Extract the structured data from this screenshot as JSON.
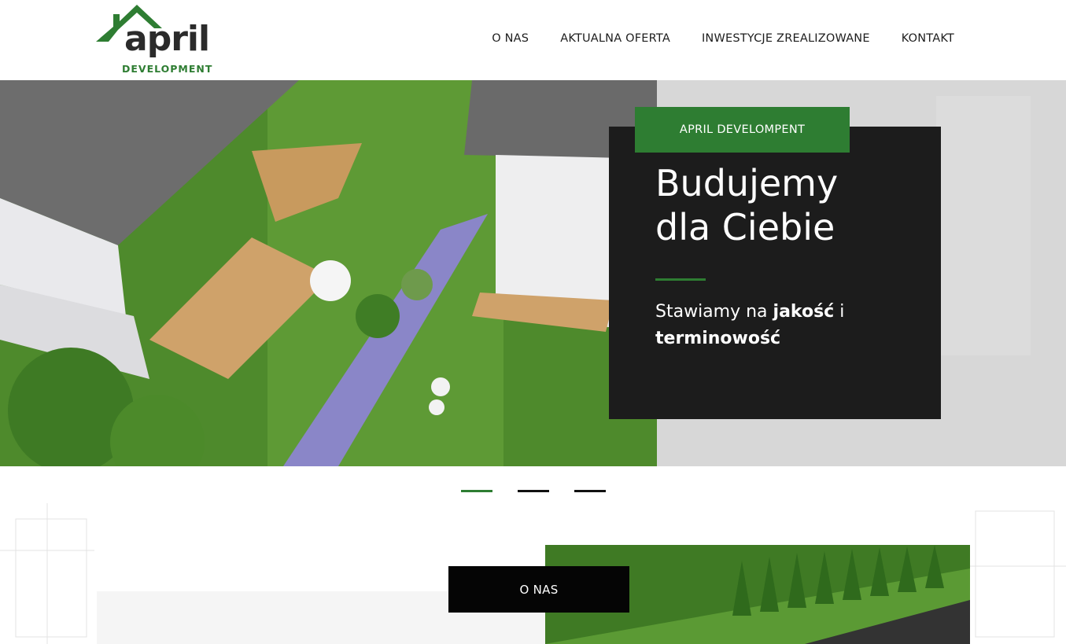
{
  "brand": {
    "name": "april",
    "sub": "DEVELOPMENT",
    "green": "#2e7d32",
    "dark": "#1c1c1c"
  },
  "nav": [
    {
      "label": "O NAS"
    },
    {
      "label": "AKTUALNA OFERTA"
    },
    {
      "label": "INWESTYCJE ZREALIZOWANE"
    },
    {
      "label": "KONTAKT"
    }
  ],
  "hero": {
    "tag": "APRIL DEVELOMPENT",
    "title_line1": "Budujemy",
    "title_line2": "dla Ciebie",
    "text_pre": "Stawiamy na ",
    "text_bold1": "jakość",
    "text_mid": " i",
    "text_bold2": "terminowość"
  },
  "slider": {
    "active_index": 1,
    "count": 3
  },
  "about": {
    "button_label": "O NAS"
  }
}
